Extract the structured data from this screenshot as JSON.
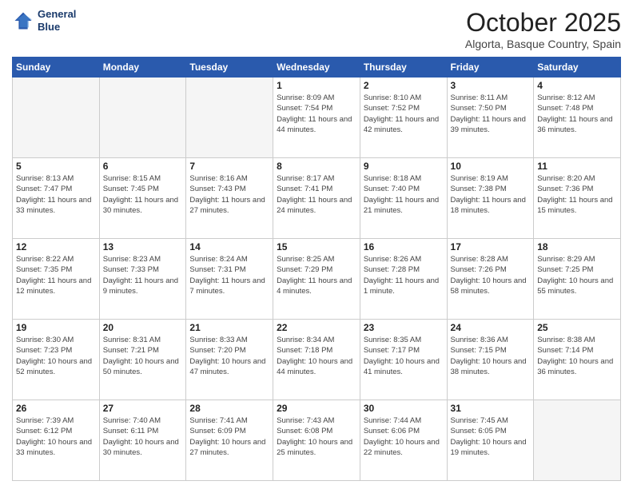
{
  "header": {
    "logo_line1": "General",
    "logo_line2": "Blue",
    "month": "October 2025",
    "location": "Algorta, Basque Country, Spain"
  },
  "days_of_week": [
    "Sunday",
    "Monday",
    "Tuesday",
    "Wednesday",
    "Thursday",
    "Friday",
    "Saturday"
  ],
  "weeks": [
    [
      {
        "day": "",
        "info": ""
      },
      {
        "day": "",
        "info": ""
      },
      {
        "day": "",
        "info": ""
      },
      {
        "day": "1",
        "info": "Sunrise: 8:09 AM\nSunset: 7:54 PM\nDaylight: 11 hours and 44 minutes."
      },
      {
        "day": "2",
        "info": "Sunrise: 8:10 AM\nSunset: 7:52 PM\nDaylight: 11 hours and 42 minutes."
      },
      {
        "day": "3",
        "info": "Sunrise: 8:11 AM\nSunset: 7:50 PM\nDaylight: 11 hours and 39 minutes."
      },
      {
        "day": "4",
        "info": "Sunrise: 8:12 AM\nSunset: 7:48 PM\nDaylight: 11 hours and 36 minutes."
      }
    ],
    [
      {
        "day": "5",
        "info": "Sunrise: 8:13 AM\nSunset: 7:47 PM\nDaylight: 11 hours and 33 minutes."
      },
      {
        "day": "6",
        "info": "Sunrise: 8:15 AM\nSunset: 7:45 PM\nDaylight: 11 hours and 30 minutes."
      },
      {
        "day": "7",
        "info": "Sunrise: 8:16 AM\nSunset: 7:43 PM\nDaylight: 11 hours and 27 minutes."
      },
      {
        "day": "8",
        "info": "Sunrise: 8:17 AM\nSunset: 7:41 PM\nDaylight: 11 hours and 24 minutes."
      },
      {
        "day": "9",
        "info": "Sunrise: 8:18 AM\nSunset: 7:40 PM\nDaylight: 11 hours and 21 minutes."
      },
      {
        "day": "10",
        "info": "Sunrise: 8:19 AM\nSunset: 7:38 PM\nDaylight: 11 hours and 18 minutes."
      },
      {
        "day": "11",
        "info": "Sunrise: 8:20 AM\nSunset: 7:36 PM\nDaylight: 11 hours and 15 minutes."
      }
    ],
    [
      {
        "day": "12",
        "info": "Sunrise: 8:22 AM\nSunset: 7:35 PM\nDaylight: 11 hours and 12 minutes."
      },
      {
        "day": "13",
        "info": "Sunrise: 8:23 AM\nSunset: 7:33 PM\nDaylight: 11 hours and 9 minutes."
      },
      {
        "day": "14",
        "info": "Sunrise: 8:24 AM\nSunset: 7:31 PM\nDaylight: 11 hours and 7 minutes."
      },
      {
        "day": "15",
        "info": "Sunrise: 8:25 AM\nSunset: 7:29 PM\nDaylight: 11 hours and 4 minutes."
      },
      {
        "day": "16",
        "info": "Sunrise: 8:26 AM\nSunset: 7:28 PM\nDaylight: 11 hours and 1 minute."
      },
      {
        "day": "17",
        "info": "Sunrise: 8:28 AM\nSunset: 7:26 PM\nDaylight: 10 hours and 58 minutes."
      },
      {
        "day": "18",
        "info": "Sunrise: 8:29 AM\nSunset: 7:25 PM\nDaylight: 10 hours and 55 minutes."
      }
    ],
    [
      {
        "day": "19",
        "info": "Sunrise: 8:30 AM\nSunset: 7:23 PM\nDaylight: 10 hours and 52 minutes."
      },
      {
        "day": "20",
        "info": "Sunrise: 8:31 AM\nSunset: 7:21 PM\nDaylight: 10 hours and 50 minutes."
      },
      {
        "day": "21",
        "info": "Sunrise: 8:33 AM\nSunset: 7:20 PM\nDaylight: 10 hours and 47 minutes."
      },
      {
        "day": "22",
        "info": "Sunrise: 8:34 AM\nSunset: 7:18 PM\nDaylight: 10 hours and 44 minutes."
      },
      {
        "day": "23",
        "info": "Sunrise: 8:35 AM\nSunset: 7:17 PM\nDaylight: 10 hours and 41 minutes."
      },
      {
        "day": "24",
        "info": "Sunrise: 8:36 AM\nSunset: 7:15 PM\nDaylight: 10 hours and 38 minutes."
      },
      {
        "day": "25",
        "info": "Sunrise: 8:38 AM\nSunset: 7:14 PM\nDaylight: 10 hours and 36 minutes."
      }
    ],
    [
      {
        "day": "26",
        "info": "Sunrise: 7:39 AM\nSunset: 6:12 PM\nDaylight: 10 hours and 33 minutes."
      },
      {
        "day": "27",
        "info": "Sunrise: 7:40 AM\nSunset: 6:11 PM\nDaylight: 10 hours and 30 minutes."
      },
      {
        "day": "28",
        "info": "Sunrise: 7:41 AM\nSunset: 6:09 PM\nDaylight: 10 hours and 27 minutes."
      },
      {
        "day": "29",
        "info": "Sunrise: 7:43 AM\nSunset: 6:08 PM\nDaylight: 10 hours and 25 minutes."
      },
      {
        "day": "30",
        "info": "Sunrise: 7:44 AM\nSunset: 6:06 PM\nDaylight: 10 hours and 22 minutes."
      },
      {
        "day": "31",
        "info": "Sunrise: 7:45 AM\nSunset: 6:05 PM\nDaylight: 10 hours and 19 minutes."
      },
      {
        "day": "",
        "info": ""
      }
    ]
  ]
}
